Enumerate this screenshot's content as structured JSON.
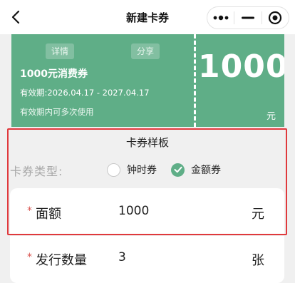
{
  "header": {
    "title": "新建卡券",
    "back_icon": "chevron-left-icon",
    "capsule_icons": [
      "more-dots-icon",
      "minimize-icon",
      "record-target-icon"
    ]
  },
  "coupon": {
    "details_label": "详情",
    "share_label": "分享",
    "name": "1000元消费券",
    "validity": "有效期:2026.04.17 - 2027.04.17",
    "note": "有效期内可多次使用",
    "amount": "1000",
    "unit": "元",
    "color": "#5fae87"
  },
  "template": {
    "title": "卡券样板",
    "type_label": "卡券类型:",
    "options": [
      {
        "label": "钟时券",
        "checked": false
      },
      {
        "label": "金额券",
        "checked": true
      }
    ]
  },
  "form": {
    "face_value": {
      "required_mark": "*",
      "label": "面额",
      "value": "1000",
      "unit": "元"
    },
    "quantity": {
      "required_mark": "*",
      "label": "发行数量",
      "value": "3",
      "unit": "张"
    }
  },
  "colors": {
    "accent": "#5fae87",
    "highlight": "#e0393c",
    "required": "#d9534f"
  }
}
